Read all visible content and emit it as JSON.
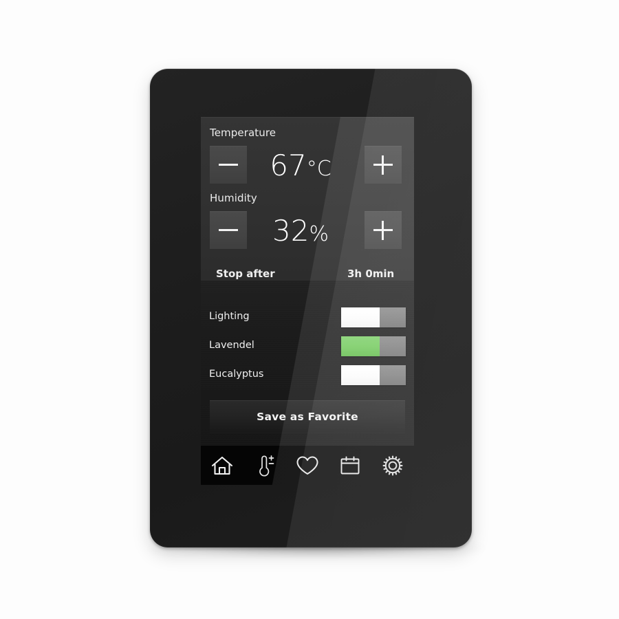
{
  "device": {
    "type": "wall-mounted touch control panel"
  },
  "screen": {
    "temperature": {
      "label": "Temperature",
      "value": "67",
      "unit": "°C",
      "decrease_label": "−",
      "increase_label": "+"
    },
    "humidity": {
      "label": "Humidity",
      "value": "32",
      "unit": "%",
      "decrease_label": "−",
      "increase_label": "+"
    },
    "timer": {
      "label": "Stop after",
      "value": "3h 0min"
    },
    "toggles": [
      {
        "label": "Lighting",
        "state": "on",
        "color": "#ffffff"
      },
      {
        "label": "Lavendel",
        "state": "on",
        "color": "#72c95c"
      },
      {
        "label": "Eucalyptus",
        "state": "on",
        "color": "#ffffff"
      }
    ],
    "save_button": {
      "label": "Save as Favorite"
    },
    "nav": [
      {
        "id": "home",
        "icon": "home-icon",
        "label": "Home"
      },
      {
        "id": "climate",
        "icon": "thermometer-icon",
        "label": "Climate"
      },
      {
        "id": "favorites",
        "icon": "heart-icon",
        "label": "Favorites"
      },
      {
        "id": "schedule",
        "icon": "calendar-icon",
        "label": "Schedule"
      },
      {
        "id": "settings",
        "icon": "gear-icon",
        "label": "Settings"
      }
    ]
  },
  "colors": {
    "accent_green": "#72c95c",
    "toggle_on_white": "#ffffff",
    "toggle_track": "#808080",
    "screen_background": "#0a0a0a",
    "panel_background": "#313131",
    "text": "#efefef"
  }
}
